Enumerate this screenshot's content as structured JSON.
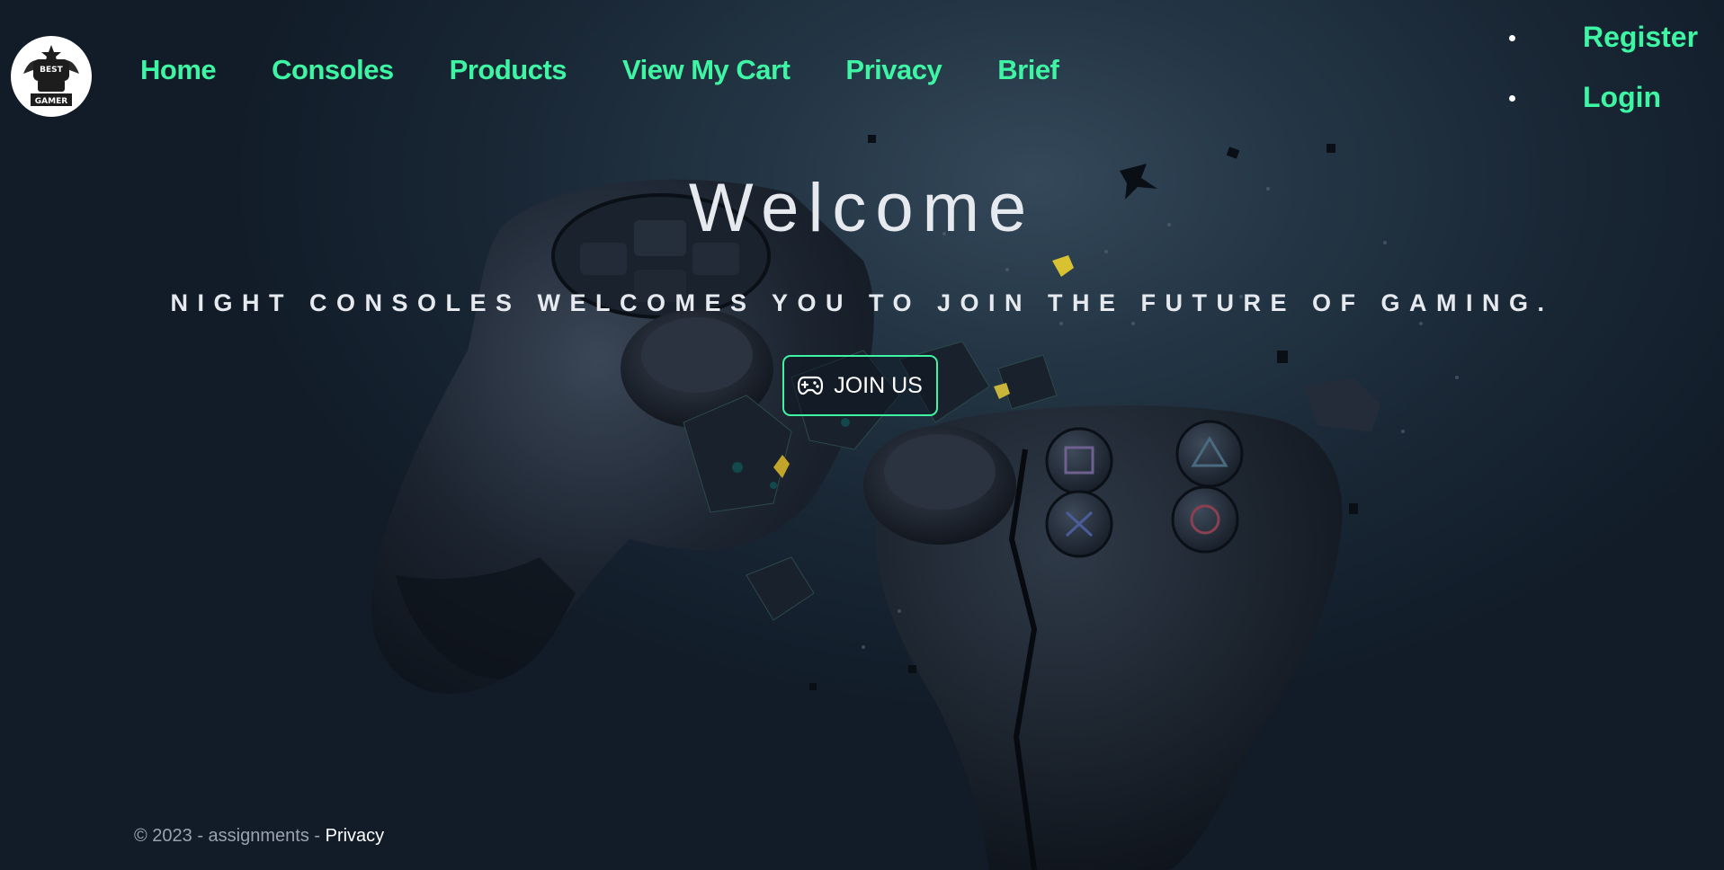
{
  "logo": {
    "alt": "Best Gamer logo",
    "top_text": "BEST",
    "bottom_text": "GAMER"
  },
  "nav": {
    "items": [
      {
        "label": "Home"
      },
      {
        "label": "Consoles"
      },
      {
        "label": "Products"
      },
      {
        "label": "View My Cart"
      },
      {
        "label": "Privacy"
      },
      {
        "label": "Brief"
      }
    ]
  },
  "auth": {
    "register_label": "Register",
    "login_label": "Login"
  },
  "hero": {
    "title": "Welcome",
    "tagline": "NIGHT CONSOLES WELCOMES YOU TO JOIN THE FUTURE OF GAMING.",
    "join_button_label": "JOIN US",
    "join_button_icon": "gamepad-icon",
    "background_image": "shattered-game-controller"
  },
  "footer": {
    "copyright": "© 2023 - assignments - ",
    "privacy_link": "Privacy"
  },
  "colors": {
    "accent": "#3ef5a4",
    "background": "#182533",
    "text": "#e6e9ee",
    "footer_text": "#9aa3ad"
  }
}
